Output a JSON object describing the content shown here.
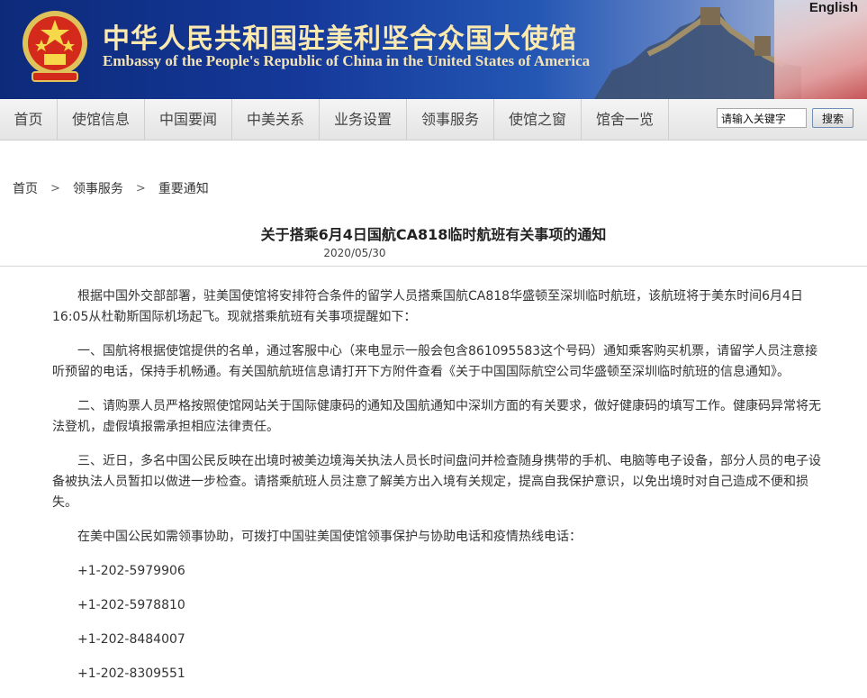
{
  "header": {
    "title_cn": "中华人民共和国驻美利坚合众国大使馆",
    "title_en": "Embassy of the People's Republic of China in the United States of America",
    "english_link": "English"
  },
  "nav": {
    "items": [
      "首页",
      "使馆信息",
      "中国要闻",
      "中美关系",
      "业务设置",
      "领事服务",
      "使馆之窗",
      "馆舍一览"
    ],
    "search_placeholder": "请输入关键字",
    "search_button": "搜索"
  },
  "breadcrumb": [
    "首页",
    "领事服务",
    "重要通知"
  ],
  "article": {
    "title": "关于搭乘6月4日国航CA818临时航班有关事项的通知",
    "date": "2020/05/30",
    "paragraphs": [
      "根据中国外交部部署，驻美国使馆将安排符合条件的留学人员搭乘国航CA818华盛顿至深圳临时航班，该航班将于美东时间6月4日16:05从杜勒斯国际机场起飞。现就搭乘航班有关事项提醒如下：",
      "一、国航将根据使馆提供的名单，通过客服中心（来电显示一般会包含861095583这个号码）通知乘客购买机票，请留学人员注意接听预留的电话，保持手机畅通。有关国航航班信息请打开下方附件查看《关于中国国际航空公司华盛顿至深圳临时航班的信息通知》。",
      "二、请购票人员严格按照使馆网站关于国际健康码的通知及国航通知中深圳方面的有关要求，做好健康码的填写工作。健康码异常将无法登机，虚假填报需承担相应法律责任。",
      "三、近日，多名中国公民反映在出境时被美边境海关执法人员长时间盘问并检查随身携带的手机、电脑等电子设备，部分人员的电子设备被执法人员暂扣以做进一步检查。请搭乘航班人员注意了解美方出入境有关规定，提高自我保护意识，以免出境时对自己造成不便和损失。",
      "在美中国公民如需领事协助，可拨打中国驻美国使馆领事保护与协助电话和疫情热线电话："
    ],
    "phones": [
      "+1-202-5979906",
      "+1-202-5978810",
      "+1-202-8484007",
      "+1-202-8309551"
    ]
  },
  "colors": {
    "banner_dark": "#0d2a7a",
    "title_gold": "#fbe9b0",
    "nav_bg": "#eeeeee"
  },
  "icons": [
    "national-emblem-icon",
    "great-wall-image"
  ]
}
